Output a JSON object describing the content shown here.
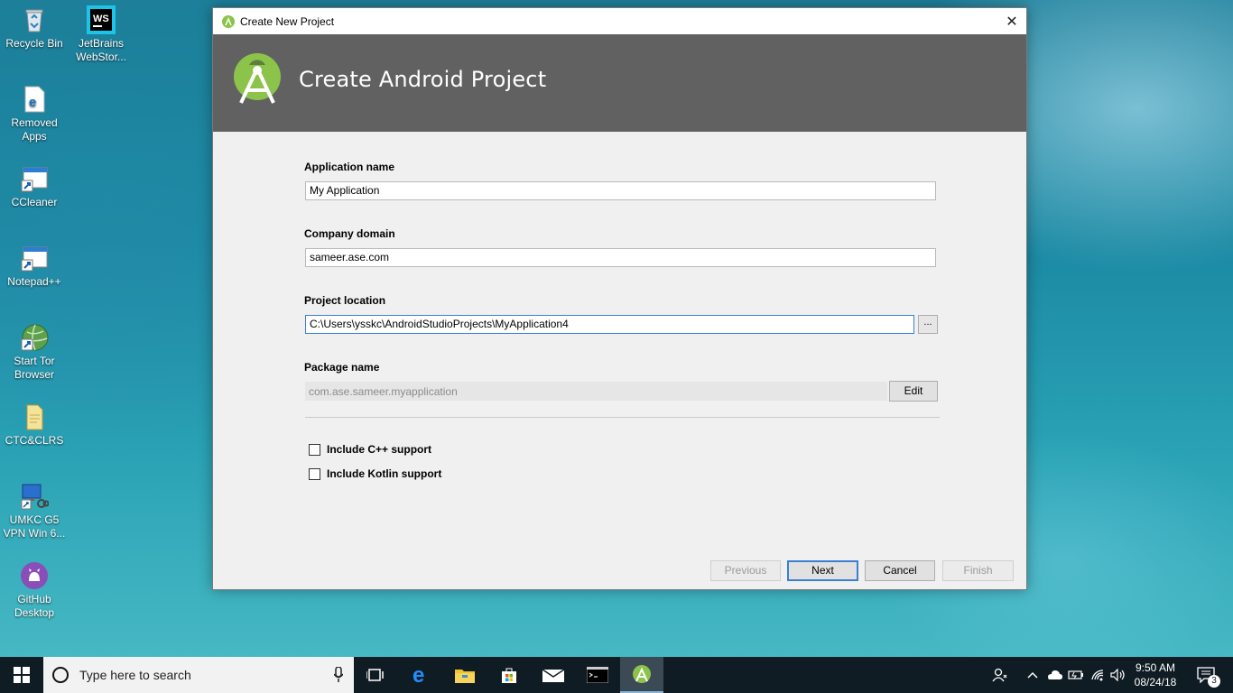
{
  "desktop": {
    "icons": [
      {
        "label": "Recycle Bin"
      },
      {
        "label": "JetBrains WebStor..."
      },
      {
        "label": "Removed Apps"
      },
      {
        "label": "CCleaner"
      },
      {
        "label": "Notepad++"
      },
      {
        "label": "Start Tor Browser"
      },
      {
        "label": "CTC&CLRS"
      },
      {
        "label": "UMKC G5 VPN Win 6..."
      },
      {
        "label": "GitHub Desktop"
      }
    ]
  },
  "dialog": {
    "window_title": "Create New Project",
    "header_title": "Create Android Project",
    "fields": {
      "app_name_label": "Application name",
      "app_name_value": "My Application",
      "company_domain_label": "Company domain",
      "company_domain_value": "sameer.ase.com",
      "project_location_label": "Project location",
      "project_location_value": "C:\\Users\\ysskc\\AndroidStudioProjects\\MyApplication4",
      "browse_label": "...",
      "package_name_label": "Package name",
      "package_name_value": "com.ase.sameer.myapplication",
      "edit_label": "Edit"
    },
    "options": {
      "cpp_label": "Include C++ support",
      "cpp_checked": false,
      "kotlin_label": "Include Kotlin support",
      "kotlin_checked": false
    },
    "buttons": {
      "previous": "Previous",
      "next": "Next",
      "cancel": "Cancel",
      "finish": "Finish"
    },
    "colors": {
      "header_bg": "#616161",
      "android_green": "#8cc34a",
      "focus_blue": "#3a7fd4"
    }
  },
  "taskbar": {
    "search_placeholder": "Type here to search",
    "pinned": [
      "task-view-icon",
      "edge-icon",
      "file-explorer-icon",
      "store-icon",
      "mail-icon",
      "cmd-icon",
      "android-studio-icon"
    ],
    "time": "9:50 AM",
    "date": "08/24/18",
    "notification_count": "3"
  }
}
